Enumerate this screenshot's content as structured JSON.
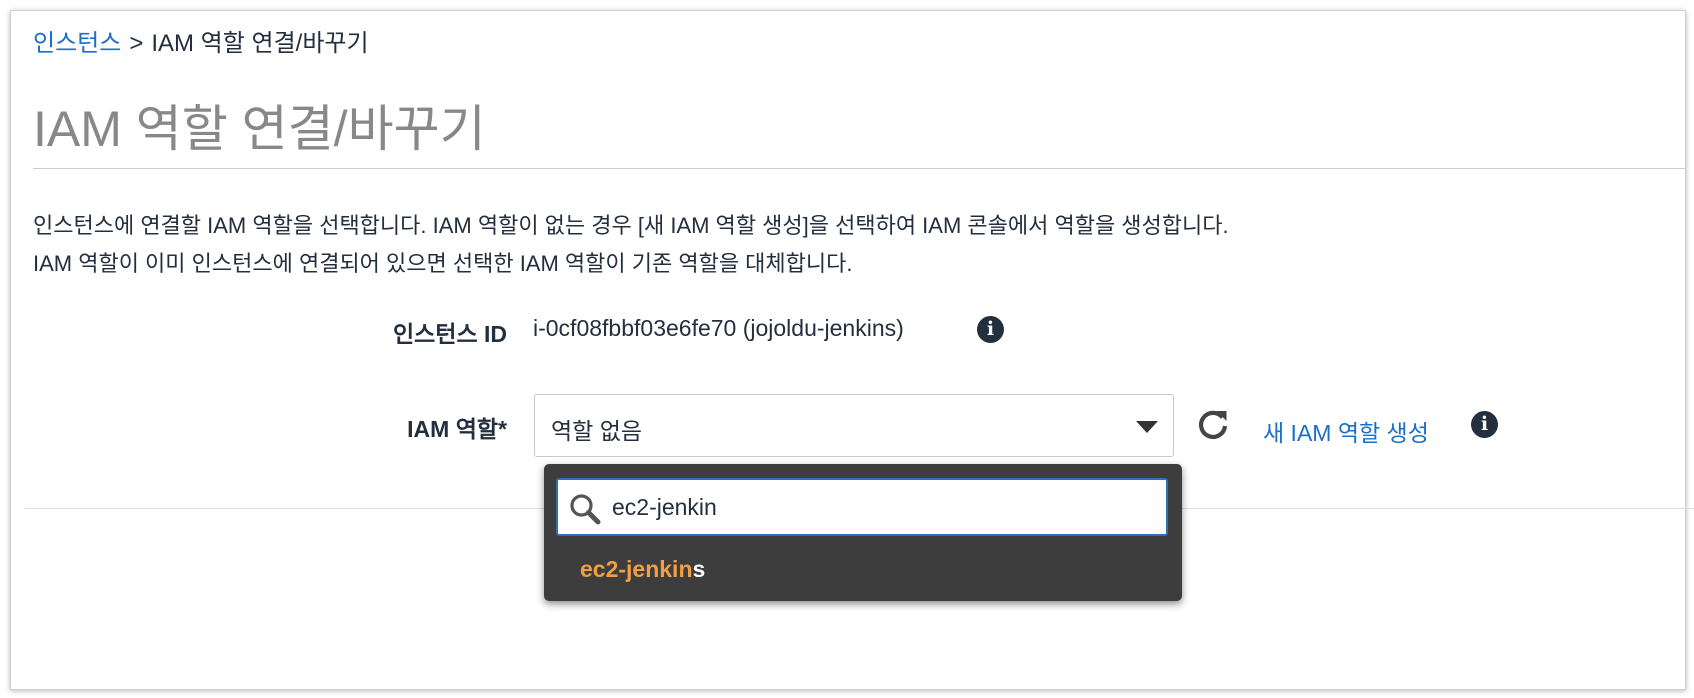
{
  "breadcrumb": {
    "link": "인스턴스",
    "separator": ">",
    "current": "IAM 역할 연결/바꾸기"
  },
  "page": {
    "title": "IAM 역할 연결/바꾸기",
    "description": [
      "인스턴스에 연결할 IAM 역할을 선택합니다. IAM 역할이 없는 경우 [새 IAM 역할 생성]을 선택하여 IAM 콘솔에서 역할을 생성합니다.",
      "IAM 역할이 이미 인스턴스에 연결되어 있으면 선택한 IAM 역할이 기존 역할을 대체합니다."
    ]
  },
  "form": {
    "instance_label": "인스턴스 ID",
    "instance_value": "i-0cf08fbbf03e6fe70 (jojoldu-jenkins)",
    "role_label": "IAM 역할*",
    "role_selected": "역할 없음",
    "create_role_link": "새 IAM 역할 생성",
    "info_icon_glyph": "i"
  },
  "dropdown": {
    "search_value": "ec2-jenkin",
    "options": [
      {
        "match": "ec2-jenkin",
        "rest": "s"
      }
    ]
  },
  "icons": {
    "info": "info-icon",
    "refresh": "refresh-icon",
    "search": "search-icon",
    "caret": "chevron-down-icon"
  },
  "colors": {
    "link": "#1a6fc9",
    "title": "#888888",
    "dropdown_bg": "#3d3d3d",
    "search_border": "#2f6fb5",
    "match_highlight": "#f0a042"
  }
}
